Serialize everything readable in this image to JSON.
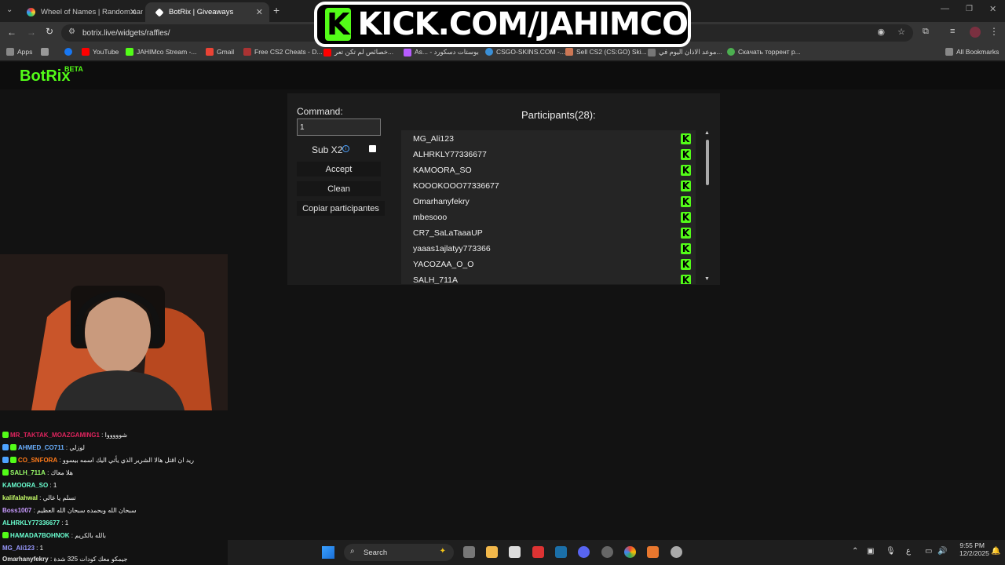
{
  "browser": {
    "tabs": [
      {
        "title": "Wheel of Names | Random nam",
        "active": false
      },
      {
        "title": "BotRix | Giveaways",
        "active": true
      }
    ],
    "new_tab": "+",
    "url": "botrix.live/widgets/raffles/",
    "bookmarks": [
      {
        "label": "Apps",
        "icon": "apps-grid-icon"
      },
      {
        "label": "",
        "icon": "grid-icon"
      },
      {
        "label": "",
        "icon": "facebook-icon"
      },
      {
        "label": "YouTube",
        "icon": "youtube-icon"
      },
      {
        "label": "JAHIMco Stream -...",
        "icon": "kick-icon"
      },
      {
        "label": "Gmail",
        "icon": "gmail-icon"
      },
      {
        "label": "Free CS2 Cheats - D...",
        "icon": "cheat-icon"
      },
      {
        "label": "خصائص لم تكن تعر...",
        "icon": "youtube-icon"
      },
      {
        "label": "As... - بوستات دسكورد",
        "icon": "discord-icon"
      },
      {
        "label": "CSGO-SKINS.COM -...",
        "icon": "skins-icon"
      },
      {
        "label": "Sell CS2 (CS:GO) Ski...",
        "icon": "sell-icon"
      },
      {
        "label": "موعد الاذان اليوم في...",
        "icon": "prayer-icon"
      },
      {
        "label": "Скачать торрент р...",
        "icon": "torrent-icon"
      }
    ],
    "all_bookmarks": "All Bookmarks"
  },
  "banner": {
    "text": "KICK.COM/JAHIMCO",
    "k": "K"
  },
  "app": {
    "logo": "BotRix",
    "logo_badge": "BETA",
    "command_label": "Command:",
    "command_value": "1",
    "sub_x2_label": "Sub X2",
    "accept": "Accept",
    "clean": "Clean",
    "copy_participants": "Copiar participantes",
    "participants_title": "Participants(28):",
    "participants": [
      "MG_Ali123",
      "ALHRKLY77336677",
      "KAMOORA_SO",
      "KOOOKOOO77336677",
      "Omarhanyfekry",
      "mbesooo",
      "CR7_SaLaTaaaUP",
      "yaaas1ajlatyy773366",
      "YACOZAA_O_O",
      "SALH_711A"
    ]
  },
  "chat": [
    {
      "name": "MR_TAKTAK_MOAZGAMING1",
      "text": ": شوووووا",
      "color": "#e0245e"
    },
    {
      "name": "AHMED_CO711",
      "text": ": لوزلي",
      "color": "#6ab0ff"
    },
    {
      "name": "CO_SNFORA",
      "text": ": ريد ان اقتل هالا الشرير الذي يأتي اليك اسمه بيسوو",
      "color": "#ff7a1a"
    },
    {
      "name": "SALH_711A",
      "text": ": هلا معاك",
      "color": "#9aff6a"
    },
    {
      "name": "KAMOORA_SO",
      "text": ": 1",
      "color": "#6affd0"
    },
    {
      "name": "kalifalahwal",
      "text": ": تسلم يا غالي",
      "color": "#c8ff6a"
    },
    {
      "name": "Boss1007",
      "text": ": سبحان الله وبحمده سبحان الله العظيم",
      "color": "#c89aff"
    },
    {
      "name": "ALHRKLY77336677",
      "text": ": 1",
      "color": "#6affd0"
    },
    {
      "name": "HAMADA7BOHNOK",
      "text": ": بالله بالكريم",
      "color": "#6affd0"
    },
    {
      "name": "MG_Ali123",
      "text": ": 1",
      "color": "#9a9aff"
    },
    {
      "name": "Omarhanyfekry",
      "text": ": جيمكو معك كودات 325 شدة",
      "color": "#e6e6e6"
    }
  ],
  "taskbar": {
    "search": "Search",
    "lang": "ع",
    "time": "9:55 PM",
    "date": "12/2/2025"
  },
  "colors": {
    "kick_green": "#53fc18",
    "bg": "#121212",
    "panel": "#1c1c1c",
    "list": "#252525"
  }
}
